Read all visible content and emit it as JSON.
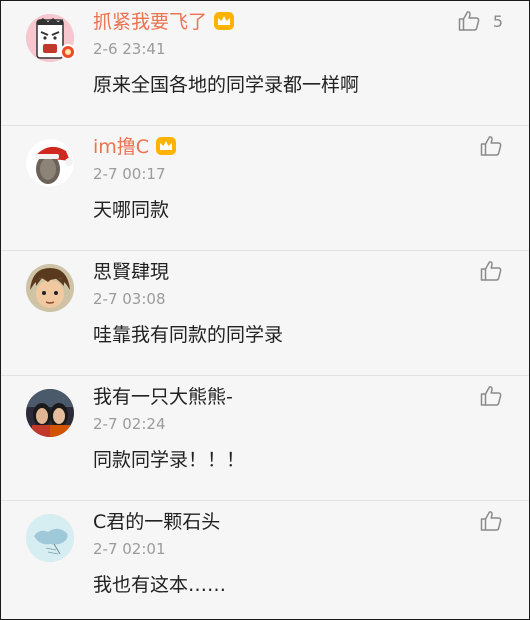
{
  "comments": [
    {
      "username": "抓紧我要飞了",
      "vip": true,
      "time": "2-6 23:41",
      "text": "原来全国各地的同学录都一样啊",
      "likes": "5"
    },
    {
      "username": "im撸C",
      "vip": true,
      "time": "2-7 00:17",
      "text": "天哪同款",
      "likes": ""
    },
    {
      "username": "思賢肆現",
      "vip": false,
      "time": "2-7 03:08",
      "text": "哇靠我有同款的同学录",
      "likes": ""
    },
    {
      "username": "我有一只大熊熊-",
      "vip": false,
      "time": "2-7 02:24",
      "text": "同款同学录！！！",
      "likes": ""
    },
    {
      "username": "C君的一颗石头",
      "vip": false,
      "time": "2-7 02:01",
      "text": "我也有这本……",
      "likes": ""
    }
  ],
  "colors": {
    "vip_name": "#eb7350",
    "time": "#9b9b9b",
    "text": "#222222",
    "background": "#f6f6f6"
  }
}
